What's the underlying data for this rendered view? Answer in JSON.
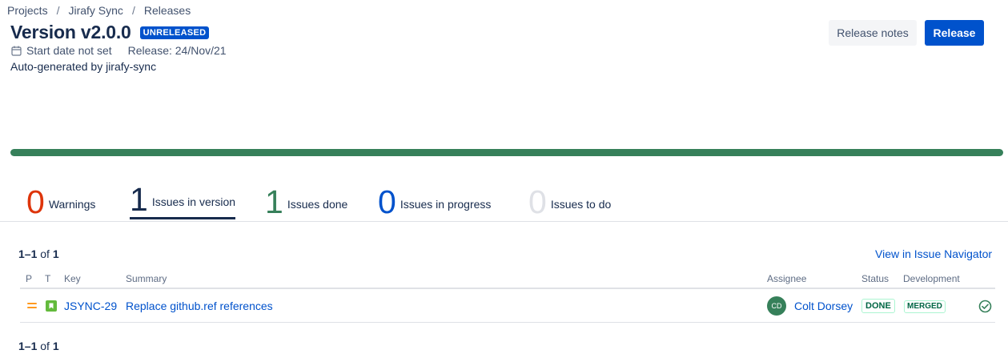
{
  "breadcrumb": [
    "Projects",
    "Jirafy Sync",
    "Releases"
  ],
  "breadcrumb_sep": "/",
  "title": "Version v2.0.0",
  "status_lozenge": "UNRELEASED",
  "meta": {
    "start_date": "Start date not set",
    "release_date": "Release: 24/Nov/21"
  },
  "description": "Auto-generated by jirafy-sync",
  "buttons": {
    "release_notes": "Release notes",
    "release": "Release"
  },
  "progress": {
    "done_fraction": 1.0,
    "color": "#36805a"
  },
  "stats": [
    {
      "num": "0",
      "label": "Warnings",
      "color": "#de350b"
    },
    {
      "num": "1",
      "label": "Issues in version",
      "color": "#172b4d"
    },
    {
      "num": "1",
      "label": "Issues done",
      "color": "#36805a"
    },
    {
      "num": "0",
      "label": "Issues in progress",
      "color": "#0052cc"
    },
    {
      "num": "0",
      "label": "Issues to do",
      "color": "#dfe1e6"
    }
  ],
  "count": {
    "range": "1–1",
    "of": "of",
    "total": "1"
  },
  "view_navigator": "View in Issue Navigator",
  "table": {
    "headers": {
      "p": "P",
      "t": "T",
      "key": "Key",
      "summary": "Summary",
      "assignee": "Assignee",
      "status": "Status",
      "development": "Development"
    },
    "rows": [
      {
        "priority_icon": "priority-medium-icon",
        "type_icon": "story-icon",
        "key": "JSYNC-29",
        "summary": "Replace github.ref references",
        "avatar_initials": "CD",
        "assignee": "Colt Dorsey",
        "status": "DONE",
        "development": "MERGED",
        "dev_icon": "check-circle-icon"
      }
    ]
  },
  "colors": {
    "accent": "#0052cc",
    "success": "#36805a",
    "warning": "#de350b"
  }
}
